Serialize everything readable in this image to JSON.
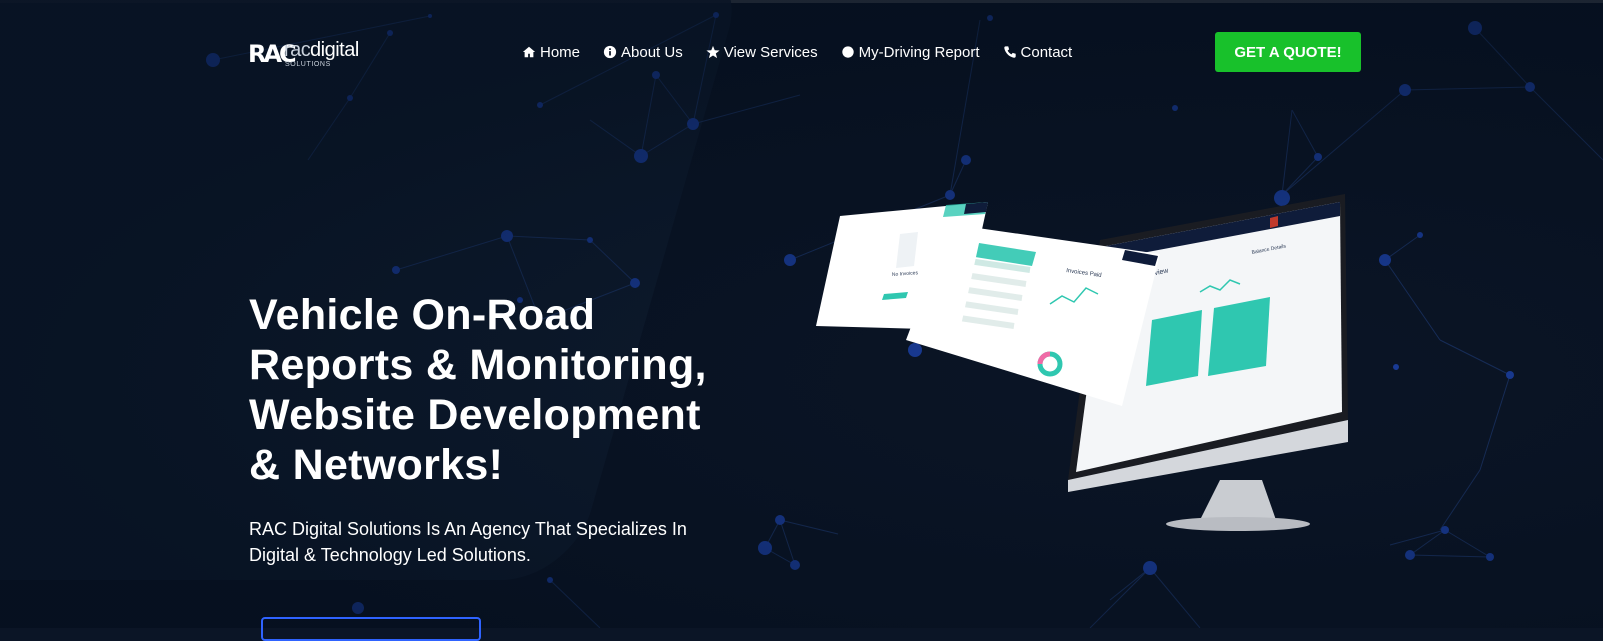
{
  "brand": {
    "logo_mark": "RAC",
    "logo_word_prefix": "rac",
    "logo_word_main": "digital",
    "logo_subtitle": "SOLUTIONS"
  },
  "nav": {
    "items": [
      {
        "label": "Home",
        "icon": "home-icon"
      },
      {
        "label": "About Us",
        "icon": "info-circle-icon"
      },
      {
        "label": "View Services",
        "icon": "star-icon"
      },
      {
        "label": "My-Driving Report",
        "icon": "circle-icon"
      },
      {
        "label": "Contact",
        "icon": "phone-icon"
      }
    ],
    "cta_label": "GET A QUOTE!"
  },
  "hero": {
    "title_lines": [
      "Vehicle On-Road",
      "Reports & Monitoring,",
      "Website Development",
      "& Networks!"
    ],
    "subtitle_lines": [
      "RAC Digital Solutions Is An Agency That Specializes In",
      "Digital & Technology Led Solutions."
    ]
  },
  "mockup": {
    "screen1_heading": "No Invoices",
    "screen2_heading": "Invoices Paid",
    "screen3_heading": "Overview",
    "screen3_side": "Balance Details"
  },
  "colors": {
    "background": "#0b1526",
    "accent_green": "#18c12b",
    "accent_blue": "#2f63ff",
    "teal": "#2fc7b0",
    "network_node": "#1b3fa0"
  }
}
